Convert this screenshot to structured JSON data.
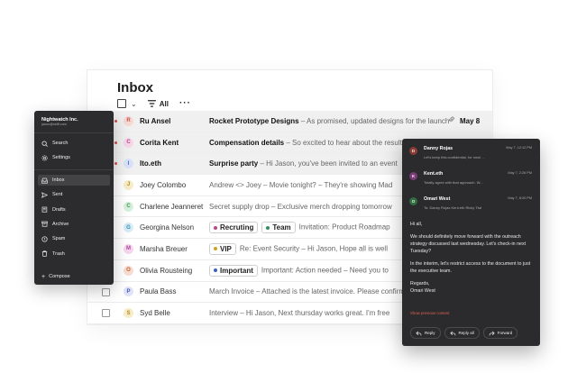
{
  "inbox": {
    "title": "Inbox",
    "filter_label": "All",
    "emails": [
      {
        "sender": "Ru Ansel",
        "initial": "R",
        "avatar_color": "#f7d9d4",
        "avatar_text": "#c0554a",
        "unread": true,
        "checkbox": false,
        "subject": "Rocket Prototype Designs",
        "snippet": " – As promised, updated designs for the launch",
        "tags": [],
        "attachment": true,
        "date": "May 8"
      },
      {
        "sender": "Corita Kent",
        "initial": "C",
        "avatar_color": "#f6d6e8",
        "avatar_text": "#b44a86",
        "unread": true,
        "checkbox": false,
        "subject": "Compensation details",
        "snippet": " – So excited to hear about the results",
        "tags": [],
        "attachment": false,
        "date": ""
      },
      {
        "sender": "Ito.eth",
        "initial": "I",
        "avatar_color": "#d8e2f7",
        "avatar_text": "#4a6dc0",
        "unread": true,
        "checkbox": false,
        "subject": "Surprise party",
        "snippet": " – Hi Jason, you've been invited to an event",
        "tags": [],
        "attachment": false,
        "date": ""
      },
      {
        "sender": "Joey Colombo",
        "initial": "J",
        "avatar_color": "#f7ecc8",
        "avatar_text": "#b08a1e",
        "unread": false,
        "checkbox": false,
        "subject": "",
        "snippet": "Andrew <> Joey – Movie tonight? – They're showing Mad",
        "tags": [],
        "attachment": false,
        "date": ""
      },
      {
        "sender": "Charlene Jeanneret",
        "initial": "C",
        "avatar_color": "#d7f0dc",
        "avatar_text": "#3c9a55",
        "unread": false,
        "checkbox": false,
        "subject": "",
        "snippet": "Secret supply drop – Exclusive merch dropping tomorrow",
        "tags": [],
        "attachment": false,
        "date": ""
      },
      {
        "sender": "Georgina Nelson",
        "initial": "G",
        "avatar_color": "#d6ecf6",
        "avatar_text": "#3a8bb3",
        "unread": false,
        "checkbox": false,
        "subject": "",
        "snippet": "Invitation: Product Roadmap",
        "tags": [
          {
            "label": "Recruting",
            "color": "#c0448a"
          },
          {
            "label": "Team",
            "color": "#2f8f5a"
          }
        ],
        "attachment": false,
        "date": ""
      },
      {
        "sender": "Marsha Breuer",
        "initial": "M",
        "avatar_color": "#f6d6ee",
        "avatar_text": "#b0479a",
        "unread": false,
        "checkbox": false,
        "subject": "",
        "snippet": "Re: Event Security – Hi Jason, Hope all is well",
        "tags": [
          {
            "label": "VIP",
            "color": "#d4a21a"
          }
        ],
        "attachment": false,
        "date": ""
      },
      {
        "sender": "Olivia Rousteing",
        "initial": "O",
        "avatar_color": "#f8dccf",
        "avatar_text": "#c4613a",
        "unread": false,
        "checkbox": false,
        "subject": "",
        "snippet": "Important: Action needed – Need you to",
        "tags": [
          {
            "label": "Important",
            "color": "#3a62c4"
          }
        ],
        "attachment": false,
        "date": ""
      },
      {
        "sender": "Paula Bass",
        "initial": "P",
        "avatar_color": "#dfe3f7",
        "avatar_text": "#4a56b8",
        "unread": false,
        "checkbox": true,
        "subject": "",
        "snippet": "March Invoice – Attached is the latest invoice. Please confirm",
        "tags": [],
        "attachment": false,
        "date": ""
      },
      {
        "sender": "Syd Belle",
        "initial": "S",
        "avatar_color": "#f7ecc8",
        "avatar_text": "#b08a1e",
        "unread": false,
        "checkbox": true,
        "subject": "",
        "snippet": "Interview – Hi Jason, Next thursday works great. I'm free",
        "tags": [],
        "attachment": false,
        "date": ""
      }
    ]
  },
  "sidebar": {
    "workspace_name": "Nightwatch Inc.",
    "workspace_email": "jason@skiff.com",
    "top_items": [
      {
        "label": "Search",
        "icon": "search-icon"
      },
      {
        "label": "Settings",
        "icon": "gear-icon"
      }
    ],
    "folders": [
      {
        "label": "Inbox",
        "icon": "inbox-icon",
        "active": true
      },
      {
        "label": "Sent",
        "icon": "send-icon",
        "active": false
      },
      {
        "label": "Drafts",
        "icon": "draft-icon",
        "active": false
      },
      {
        "label": "Archive",
        "icon": "archive-icon",
        "active": false
      },
      {
        "label": "Spam",
        "icon": "spam-icon",
        "active": false
      },
      {
        "label": "Trash",
        "icon": "trash-icon",
        "active": false
      }
    ],
    "compose_label": "Compose"
  },
  "thread": {
    "messages": [
      {
        "name": "Danny Rojas",
        "initial": "D",
        "color": "#8a3b34",
        "date": "May 7, 12:12 PM",
        "snippet": "Let's keep this confidential, for now! ..."
      },
      {
        "name": "Kent.eth",
        "initial": "K",
        "color": "#7a3b78",
        "date": "May 7, 2:26 PM",
        "snippet": "Totally agree with that approach. W..."
      },
      {
        "name": "Omari West",
        "initial": "O",
        "color": "#2f6e3f",
        "date": "May 7, 8:20 PM",
        "to": "To:  Danny Rojas   Kent.eth   Ricky Tiwi"
      }
    ],
    "body": [
      "Hi all,",
      "We should definitely move forward with the outreach strategy discussed last wednesday. Let's check-in next Tuesday?",
      "In the interim, let's restrict access to the document to just the executive team.",
      "Regards,\nOmari West"
    ],
    "show_previous": "Show previous content",
    "actions": [
      {
        "label": "Reply",
        "icon": "reply-icon"
      },
      {
        "label": "Reply all",
        "icon": "reply-all-icon"
      },
      {
        "label": "Forward",
        "icon": "forward-icon"
      }
    ]
  }
}
